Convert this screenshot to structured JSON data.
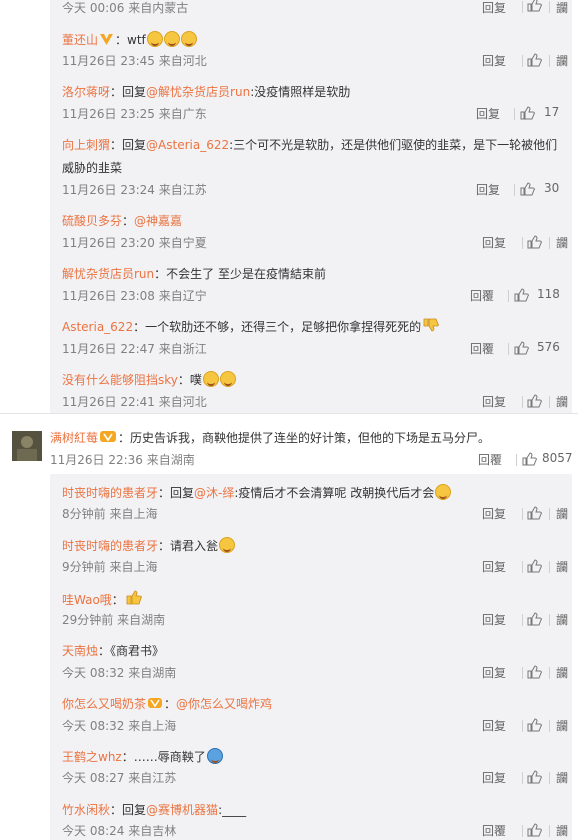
{
  "first_meta": {
    "time": "今天 00:06",
    "source": "来自内蒙古",
    "reply": "回复",
    "share": "讕"
  },
  "replies_top": [
    {
      "user": "董还山",
      "sep": "：",
      "body": "wtf",
      "time": "11月26日 23:45",
      "source": "来自河北",
      "reply": "回复",
      "share": "讕"
    },
    {
      "user": "洛尔蒋呀",
      "sep": "：",
      "prefix": "回复",
      "mention": "@解忧杂货店员run",
      "body": ":没疫情照样是软肋",
      "time": "11月26日 23:25",
      "source": "来自广东",
      "reply": "回复",
      "likes": "17"
    },
    {
      "user": "向上刺猬",
      "sep": "：",
      "prefix": "回复",
      "mention": "@Asteria_622",
      "body": ":三个可不光是软肋，还是供他们驱使的韭菜，是下一轮被他们",
      "body2": "威胁的韭菜",
      "time": "11月26日 23:24",
      "source": "来自江苏",
      "reply": "回复",
      "likes": "30"
    },
    {
      "user": "硫酸贝多芬",
      "sep": "：",
      "mention": "@神嘉嘉",
      "time": "11月26日 23:20",
      "source": "来自宁夏",
      "reply": "回复",
      "share": "讕"
    },
    {
      "user": "解忧杂货店员run",
      "sep": "：",
      "body": "不会生了 至少是在疫情結束前",
      "time": "11月26日 23:08",
      "source": "来自辽宁",
      "reply": "回覆",
      "likes": "118"
    },
    {
      "user": "Asteria_622",
      "sep": "：",
      "body": "一个软肋还不够，还得三个，足够把你拿捏得死死的",
      "time": "11月26日 22:47",
      "source": "来自浙江",
      "reply": "回覆",
      "likes": "576"
    },
    {
      "user": "没有什么能够阻挡sky",
      "sep": "：",
      "body": "噗",
      "time": "11月26日 22:41",
      "source": "来自河北",
      "reply": "回复",
      "share": "讕"
    }
  ],
  "main_comment": {
    "user": "满树紅莓",
    "sep": "：",
    "body": "历史告诉我，商鞅他提供了连坐的好计策，但他的下场是五马分尸。",
    "time": "11月26日 22:36",
    "source": "来自湖南",
    "reply": "回覆",
    "likes": "8057"
  },
  "replies_bottom": [
    {
      "user": "时丧时嗨的患者牙",
      "sep": "：",
      "prefix": "回复",
      "mention": "@沐-绎",
      "body": ":疫情后才不会清算呢 改朝换代后才会",
      "time": "8分钟前",
      "source": "来自上海",
      "reply": "回复",
      "share": "讕"
    },
    {
      "user": "时丧时嗨的患者牙",
      "sep": "：",
      "body": "请君入瓮",
      "time": "9分钟前",
      "source": "来自上海",
      "reply": "回复",
      "share": "讕"
    },
    {
      "user": "哇Wao哦",
      "sep": "：",
      "body": "",
      "time": "29分钟前",
      "source": "来自湖南",
      "reply": "回复",
      "share": "讕"
    },
    {
      "user": "天南烛",
      "sep": "：",
      "body": "《商君书》",
      "time": "今天 08:32",
      "source": "来自湖南",
      "reply": "回复",
      "share": "讕"
    },
    {
      "user": "你怎么又喝奶茶",
      "sep": "：",
      "mention": "@你怎么又喝炸鸡",
      "time": "今天 08:32",
      "source": "来自上海",
      "reply": "回复",
      "share": "讕"
    },
    {
      "user": "王鹤之whz",
      "sep": "：",
      "body": "……辱商鞅了",
      "time": "今天 08:27",
      "source": "来自江苏",
      "reply": "回复",
      "share": "讕"
    },
    {
      "user": "竹水闲秋",
      "sep": "：",
      "prefix": "回复",
      "mention": "@赛博机器猫",
      "body": ":____",
      "time": "今天 08:24",
      "source": "来自吉林",
      "reply": "回覆",
      "share": "讕"
    }
  ],
  "colors": {
    "name": "#eb7340",
    "meta": "#808080",
    "panel": "#f2f2f5"
  },
  "icons": {
    "like": "thumb-up-icon",
    "share": "share-icon",
    "emoji": "emoji-icon",
    "vip": "vip-badge-icon"
  }
}
